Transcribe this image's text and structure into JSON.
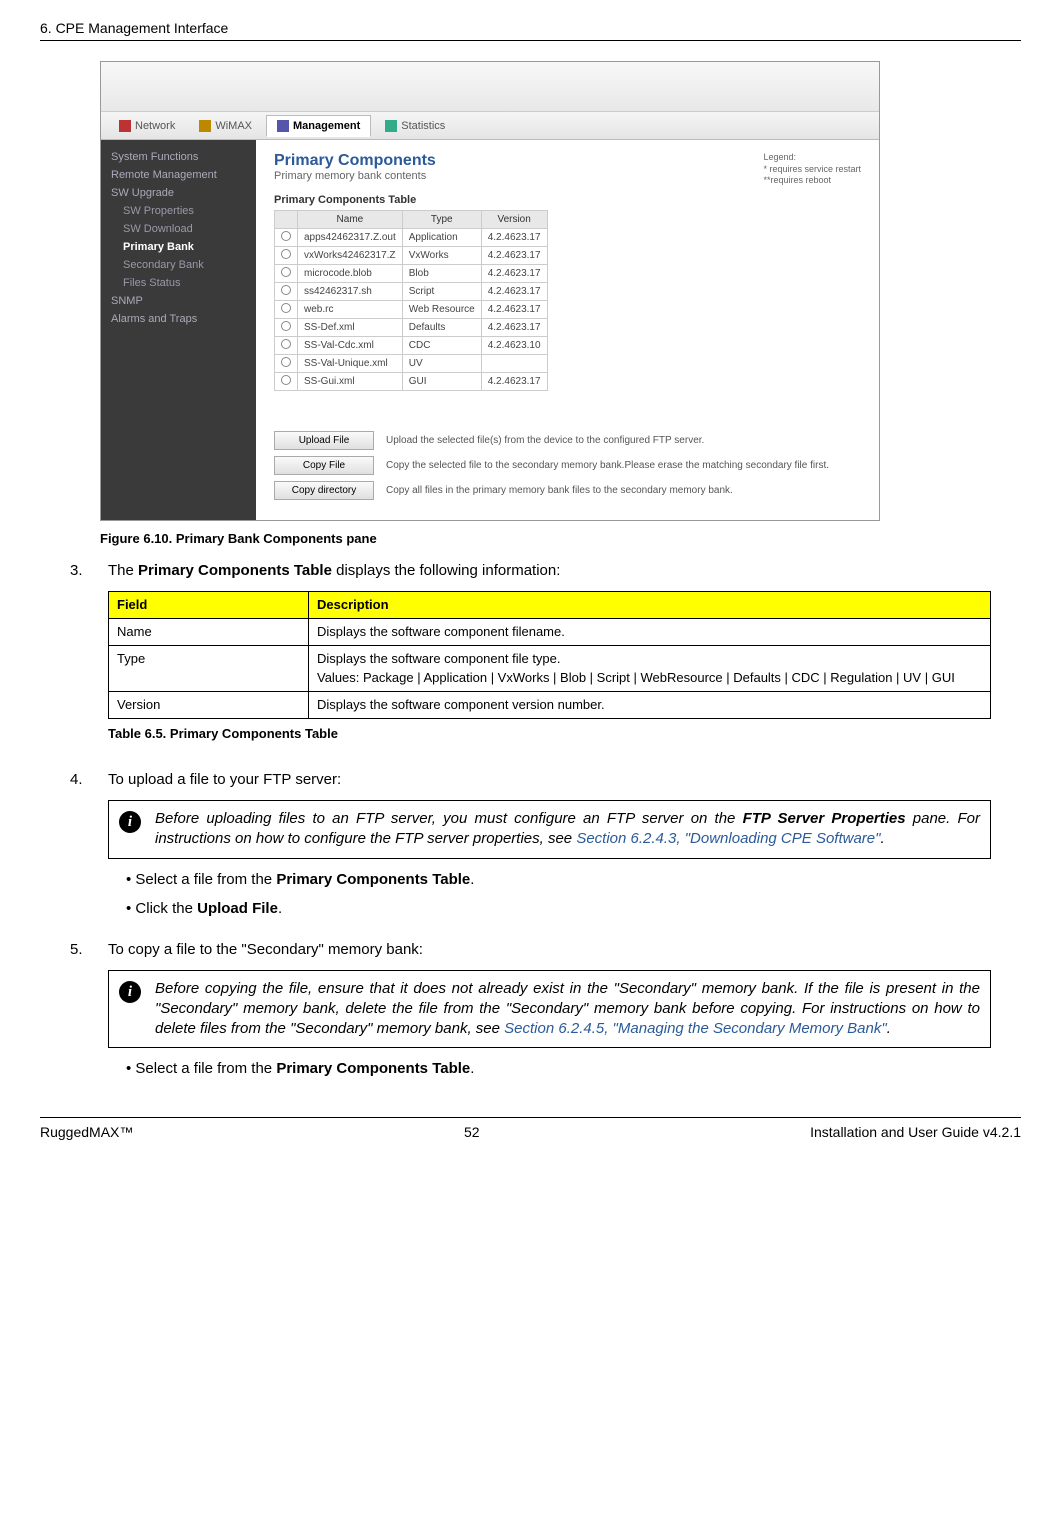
{
  "header": {
    "title": "6. CPE Management Interface"
  },
  "screenshot": {
    "tabs": [
      {
        "label": "Network",
        "active": false
      },
      {
        "label": "WiMAX",
        "active": false
      },
      {
        "label": "Management",
        "active": true
      },
      {
        "label": "Statistics",
        "active": false
      }
    ],
    "sidebar": {
      "items": [
        "System Functions",
        "Remote Management",
        "SW Upgrade"
      ],
      "sub_items": [
        {
          "label": "SW Properties",
          "active": false
        },
        {
          "label": "SW Download",
          "active": false
        },
        {
          "label": "Primary Bank",
          "active": true
        },
        {
          "label": "Secondary Bank",
          "active": false
        },
        {
          "label": "Files Status",
          "active": false
        }
      ],
      "items2": [
        "SNMP",
        "Alarms and Traps"
      ]
    },
    "panel": {
      "title": "Primary Components",
      "subtitle": "Primary memory bank contents",
      "legend_title": "Legend:",
      "legend_line1": "* requires service restart",
      "legend_line2": "**requires reboot",
      "table_label": "Primary Components Table",
      "headers": [
        "Name",
        "Type",
        "Version"
      ],
      "rows": [
        [
          "apps42462317.Z.out",
          "Application",
          "4.2.4623.17"
        ],
        [
          "vxWorks42462317.Z",
          "VxWorks",
          "4.2.4623.17"
        ],
        [
          "microcode.blob",
          "Blob",
          "4.2.4623.17"
        ],
        [
          "ss42462317.sh",
          "Script",
          "4.2.4623.17"
        ],
        [
          "web.rc",
          "Web Resource",
          "4.2.4623.17"
        ],
        [
          "SS-Def.xml",
          "Defaults",
          "4.2.4623.17"
        ],
        [
          "SS-Val-Cdc.xml",
          "CDC",
          "4.2.4623.10"
        ],
        [
          "SS-Val-Unique.xml",
          "UV",
          ""
        ],
        [
          "SS-Gui.xml",
          "GUI",
          "4.2.4623.17"
        ]
      ],
      "actions": [
        {
          "button": "Upload File",
          "desc": "Upload the selected file(s) from the device to the configured FTP server."
        },
        {
          "button": "Copy File",
          "desc": "Copy the selected file to the secondary memory bank.Please erase the matching secondary file first."
        },
        {
          "button": "Copy directory",
          "desc": "Copy all files in the primary memory bank files to the secondary memory bank."
        }
      ]
    }
  },
  "figure_caption": "Figure 6.10. Primary Bank Components pane",
  "step3": {
    "num": "3.",
    "text_before": "The ",
    "bold": "Primary Components Table",
    "text_after": " displays the following information:",
    "table": {
      "headers": [
        "Field",
        "Description"
      ],
      "rows": [
        {
          "field": "Name",
          "desc": "Displays the software component filename."
        },
        {
          "field": "Type",
          "desc_line1": "Displays the software component file type.",
          "desc_line2": "Values: Package | Application | VxWorks | Blob | Script | WebResource | Defaults | CDC | Regulation | UV | GUI"
        },
        {
          "field": "Version",
          "desc": "Displays the software component version number."
        }
      ],
      "caption": "Table 6.5. Primary Components Table"
    }
  },
  "step4": {
    "num": "4.",
    "text": "To upload a file to your FTP server:",
    "info": {
      "part1": "Before uploading files to an FTP server, you must configure an FTP server on the ",
      "bold": "FTP Server Properties",
      "part2": " pane. For instructions on how to configure the FTP server properties, see ",
      "link": "Section 6.2.4.3, \"Downloading CPE Software\"",
      "part3": "."
    },
    "bullets": [
      {
        "pre": "Select a file from the ",
        "bold": "Primary Components Table",
        "post": "."
      },
      {
        "pre": "Click the ",
        "bold": "Upload File",
        "post": "."
      }
    ]
  },
  "step5": {
    "num": "5.",
    "text": "To copy a file to the \"Secondary\" memory bank:",
    "info": {
      "part1": "Before copying the file, ensure that it does not already exist in the \"Secondary\" memory bank. If the file is present in the \"Secondary\" memory bank, delete the file from the \"Secondary\" memory bank before copying. For instructions on how to delete files from the \"Secondary\" memory bank, see ",
      "link": "Section 6.2.4.5, \"Managing the Secondary Memory Bank\"",
      "part2": "."
    },
    "bullets": [
      {
        "pre": "Select a file from the ",
        "bold": "Primary Components Table",
        "post": "."
      }
    ]
  },
  "footer": {
    "left": "RuggedMAX™",
    "center": "52",
    "right": "Installation and User Guide v4.2.1"
  }
}
